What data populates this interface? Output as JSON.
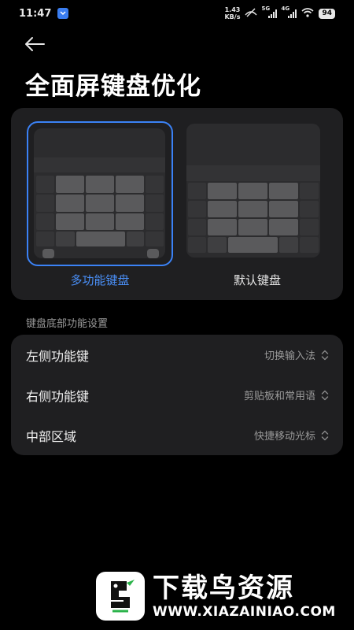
{
  "status_bar": {
    "time": "11:47",
    "net_speed_value": "1.43",
    "net_speed_unit": "KB/s",
    "sim1_tag": "5G",
    "sim2_tag": "4G",
    "battery": "94"
  },
  "page": {
    "title": "全面屏键盘优化"
  },
  "keyboard_options": [
    {
      "label": "多功能键盘",
      "selected": true
    },
    {
      "label": "默认键盘",
      "selected": false
    }
  ],
  "section": {
    "label": "键盘底部功能设置"
  },
  "settings": [
    {
      "title": "左侧功能键",
      "value": "切换输入法"
    },
    {
      "title": "右侧功能键",
      "value": "剪贴板和常用语"
    },
    {
      "title": "中部区域",
      "value": "快捷移动光标"
    }
  ],
  "watermark": {
    "title": "下载鸟资源",
    "url": "WWW.XIAZAINIAO.COM"
  },
  "colors": {
    "accent": "#3b82f6",
    "background": "#000000",
    "card": "#1f1f21"
  }
}
